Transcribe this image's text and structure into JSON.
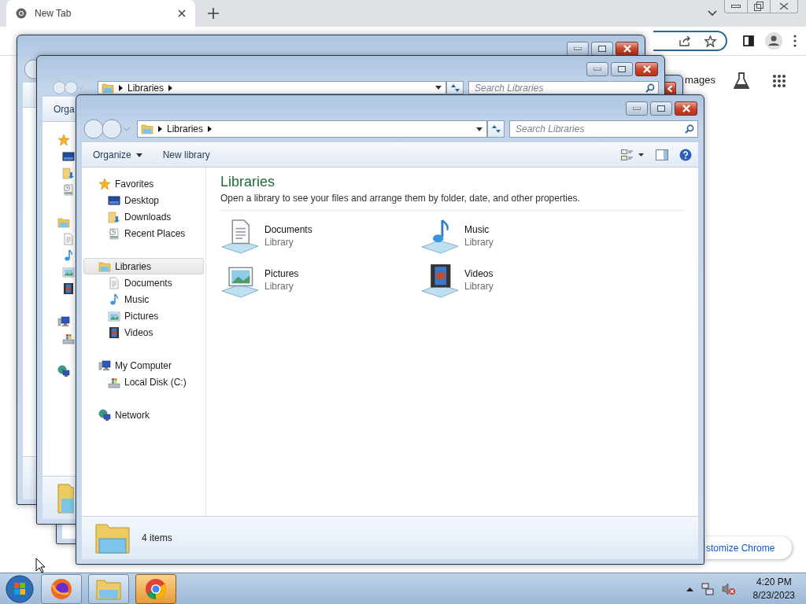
{
  "browser": {
    "tab": {
      "title": "New Tab"
    },
    "links": [
      "mages"
    ],
    "customize_button": "stomize Chrome"
  },
  "back_window": {
    "address": "Libraries",
    "search": {
      "placeholder": "Search Libraries"
    },
    "toolbar": [
      "Orga"
    ]
  },
  "explorer": {
    "address": "Libraries",
    "search": {
      "placeholder": "Search Libraries"
    },
    "toolbar": [
      "Organize",
      "New library"
    ],
    "sidebar": [
      {
        "label": "Favorites",
        "kind": "favorites",
        "selected": false,
        "children": [
          {
            "label": "Desktop",
            "kind": "desktop",
            "selected": false
          },
          {
            "label": "Downloads",
            "kind": "downloads",
            "selected": false
          },
          {
            "label": "Recent Places",
            "kind": "recent",
            "selected": false
          }
        ]
      },
      {
        "label": "Libraries",
        "kind": "library",
        "selected": true,
        "children": [
          {
            "label": "Documents",
            "kind": "documents",
            "selected": false
          },
          {
            "label": "Music",
            "kind": "music",
            "selected": false
          },
          {
            "label": "Pictures",
            "kind": "pictures",
            "selected": false
          },
          {
            "label": "Videos",
            "kind": "videos",
            "selected": false
          }
        ]
      },
      {
        "label": "My Computer",
        "kind": "computer",
        "selected": false,
        "children": [
          {
            "label": "Local Disk (C:)",
            "kind": "disk",
            "selected": false
          }
        ]
      },
      {
        "label": "Network",
        "kind": "network",
        "selected": false
      }
    ],
    "heading": "Libraries",
    "description": "Open a library to see your files and arrange them by folder, date, and other properties.",
    "libraries": [
      {
        "name": "Documents",
        "type": "Library",
        "kind": "documents"
      },
      {
        "name": "Music",
        "type": "Library",
        "kind": "music"
      },
      {
        "name": "Pictures",
        "type": "Library",
        "kind": "pictures"
      },
      {
        "name": "Videos",
        "type": "Library",
        "kind": "videos"
      }
    ],
    "status": "4 items"
  },
  "taskbar": {
    "items": [
      {
        "kind": "firefox",
        "selected": false
      },
      {
        "kind": "explorer",
        "selected": false
      },
      {
        "kind": "chrome",
        "selected": true
      }
    ],
    "time": "4:20 PM",
    "date": "8/23/2023"
  }
}
